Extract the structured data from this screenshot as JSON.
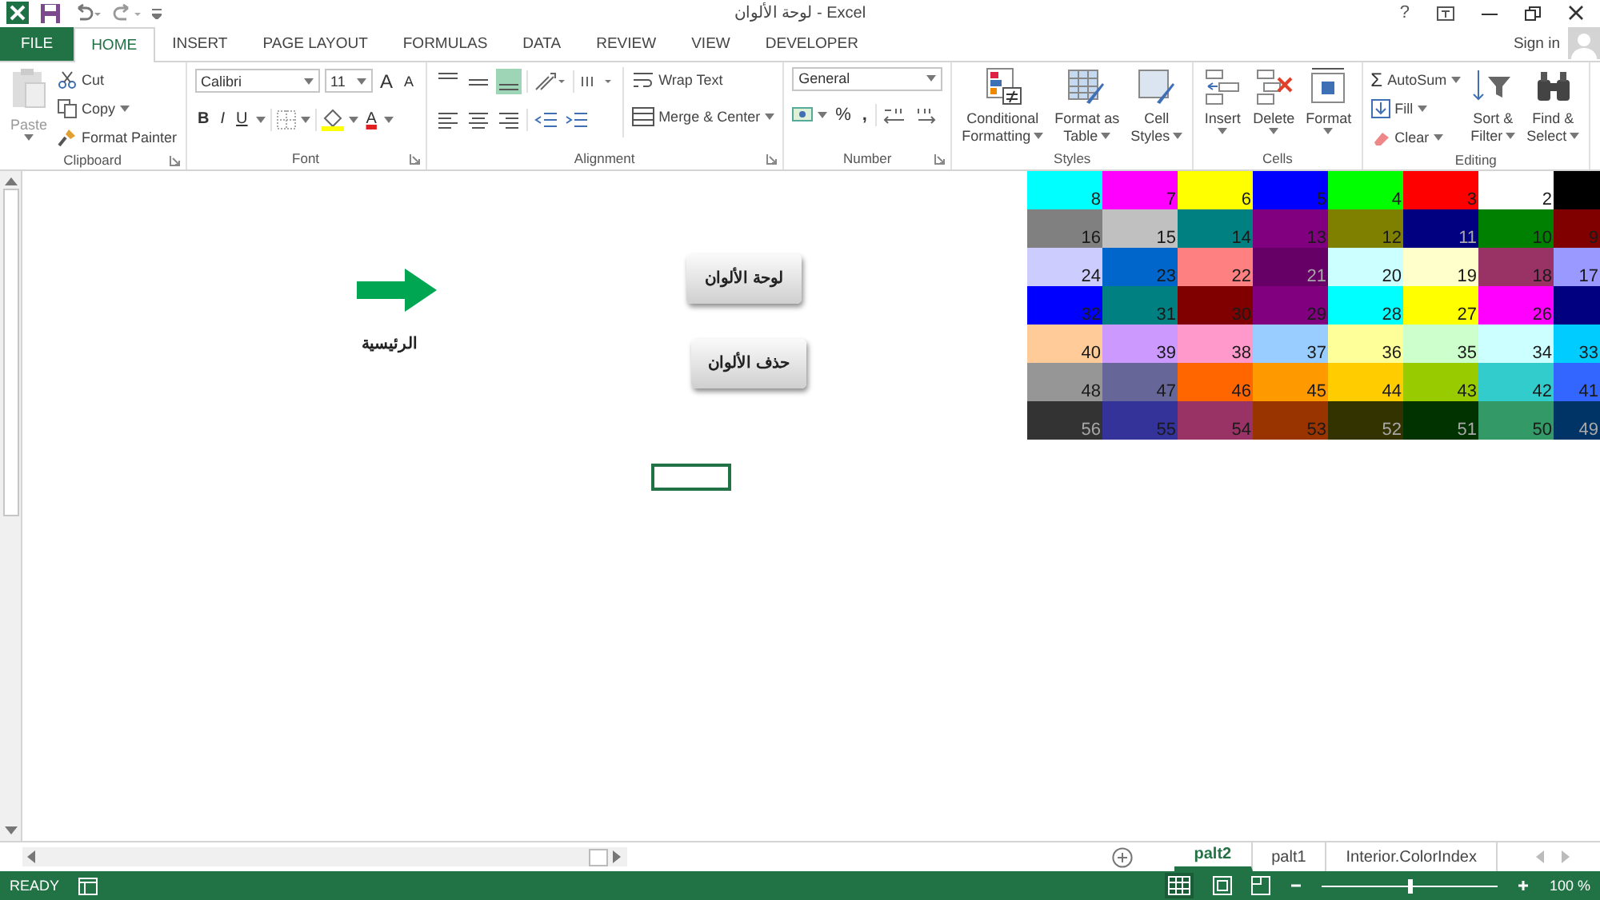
{
  "window": {
    "title": "لوحة الألوان - Excel",
    "help": "?",
    "sign_in": "Sign in"
  },
  "tabs": [
    {
      "label": "FILE",
      "kind": "file",
      "selected": false
    },
    {
      "label": "HOME",
      "kind": "tab",
      "selected": true
    },
    {
      "label": "INSERT",
      "kind": "tab",
      "selected": false
    },
    {
      "label": "PAGE LAYOUT",
      "kind": "tab",
      "selected": false
    },
    {
      "label": "FORMULAS",
      "kind": "tab",
      "selected": false
    },
    {
      "label": "DATA",
      "kind": "tab",
      "selected": false
    },
    {
      "label": "REVIEW",
      "kind": "tab",
      "selected": false
    },
    {
      "label": "VIEW",
      "kind": "tab",
      "selected": false
    },
    {
      "label": "DEVELOPER",
      "kind": "tab",
      "selected": false
    }
  ],
  "clipboard": {
    "paste": "Paste",
    "cut": "Cut",
    "copy": "Copy",
    "format_painter": "Format Painter",
    "label": "Clipboard"
  },
  "font": {
    "name": "Calibri",
    "size": "11",
    "grow": "A",
    "shrink": "A",
    "bold": "B",
    "italic": "I",
    "underline": "U",
    "color_letter": "A",
    "label": "Font"
  },
  "alignment": {
    "wrap": "Wrap Text",
    "merge": "Merge & Center",
    "label": "Alignment"
  },
  "number": {
    "format": "General",
    "percent": "%",
    "comma": ",",
    "label": "Number"
  },
  "styles": {
    "items": [
      {
        "lines": [
          "Conditional",
          "Formatting"
        ],
        "kind": "conditional"
      },
      {
        "lines": [
          "Format as",
          "Table"
        ],
        "kind": "table"
      },
      {
        "lines": [
          "Cell",
          "Styles"
        ],
        "kind": "cellstyles"
      }
    ],
    "label": "Styles"
  },
  "cells": {
    "items": [
      {
        "label": "Insert",
        "kind": "insert"
      },
      {
        "label": "Delete",
        "kind": "delete"
      },
      {
        "label": "Format",
        "kind": "format"
      }
    ],
    "label": "Cells"
  },
  "editing": {
    "sigma": "Σ",
    "autosum": "AutoSum",
    "fill": "Fill",
    "clear": "Clear",
    "sort": [
      "Sort &",
      "Filter"
    ],
    "find": [
      "Find &",
      "Select"
    ],
    "label": "Editing"
  },
  "palette": {
    "rows": [
      {
        "cells": [
          {
            "number": "8",
            "color": "#00ffff"
          },
          {
            "number": "7",
            "color": "#ff00ff"
          },
          {
            "number": "6",
            "color": "#ffff00"
          },
          {
            "number": "5",
            "color": "#0000ff"
          },
          {
            "number": "4",
            "color": "#00ff00"
          },
          {
            "number": "3",
            "color": "#ff0000"
          },
          {
            "number": "2",
            "color": "#ffffff"
          },
          {
            "color": "#000000"
          }
        ]
      },
      {
        "cells": [
          {
            "number": "16",
            "color": "#808080"
          },
          {
            "number": "15",
            "color": "#c0c0c0"
          },
          {
            "number": "14",
            "color": "#008080"
          },
          {
            "number": "13",
            "color": "#800080"
          },
          {
            "number": "12",
            "color": "#808000"
          },
          {
            "number": "11",
            "color": "#000080"
          },
          {
            "number": "10",
            "color": "#008000"
          },
          {
            "number": "9",
            "color": "#800000"
          }
        ]
      },
      {
        "cells": [
          {
            "number": "24",
            "color": "#ccccff"
          },
          {
            "number": "23",
            "color": "#0066cc"
          },
          {
            "number": "22",
            "color": "#ff8080"
          },
          {
            "number": "21",
            "color": "#660066"
          },
          {
            "number": "20",
            "color": "#ccffff"
          },
          {
            "number": "19",
            "color": "#ffffcc"
          },
          {
            "number": "18",
            "color": "#993366"
          },
          {
            "number": "17",
            "color": "#9999ff"
          }
        ]
      },
      {
        "cells": [
          {
            "number": "32",
            "color": "#0000ff"
          },
          {
            "number": "31",
            "color": "#008080"
          },
          {
            "number": "30",
            "color": "#800000"
          },
          {
            "number": "29",
            "color": "#800080"
          },
          {
            "number": "28",
            "color": "#00ffff"
          },
          {
            "number": "27",
            "color": "#ffff00"
          },
          {
            "number": "26",
            "color": "#ff00ff"
          },
          {
            "color": "#000080"
          }
        ]
      },
      {
        "cells": [
          {
            "number": "40",
            "color": "#ffcc99"
          },
          {
            "number": "39",
            "color": "#cc99ff"
          },
          {
            "number": "38",
            "color": "#ff99cc"
          },
          {
            "number": "37",
            "color": "#99ccff"
          },
          {
            "number": "36",
            "color": "#ffff99"
          },
          {
            "number": "35",
            "color": "#ccffcc"
          },
          {
            "number": "34",
            "color": "#ccffff"
          },
          {
            "number": "33",
            "color": "#00ccff"
          }
        ]
      },
      {
        "cells": [
          {
            "number": "48",
            "color": "#969696"
          },
          {
            "number": "47",
            "color": "#666699"
          },
          {
            "number": "46",
            "color": "#ff6600"
          },
          {
            "number": "45",
            "color": "#ff9900"
          },
          {
            "number": "44",
            "color": "#ffcc00"
          },
          {
            "number": "43",
            "color": "#99cc00"
          },
          {
            "number": "42",
            "color": "#33cccc"
          },
          {
            "number": "41",
            "color": "#3366ff"
          }
        ]
      },
      {
        "cells": [
          {
            "number": "56",
            "color": "#333333"
          },
          {
            "number": "55",
            "color": "#333399"
          },
          {
            "number": "54",
            "color": "#993366"
          },
          {
            "number": "53",
            "color": "#993300"
          },
          {
            "number": "52",
            "color": "#333300"
          },
          {
            "number": "51",
            "color": "#003300"
          },
          {
            "number": "50",
            "color": "#339966"
          },
          {
            "number": "49",
            "color": "#003366"
          }
        ]
      }
    ]
  },
  "shapes": {
    "arrow_label": "الرئيسية",
    "buttons": [
      "لوحة الألوان",
      "حذف الألوان"
    ]
  },
  "sheet_tabs": [
    {
      "label": "palt2",
      "selected": true
    },
    {
      "label": "palt1",
      "selected": false
    },
    {
      "label": "Interior.ColorIndex",
      "selected": false
    }
  ],
  "status_bar": {
    "status": "READY",
    "zoom_slider": {
      "level": 0.5
    },
    "zoom": "100 %"
  }
}
